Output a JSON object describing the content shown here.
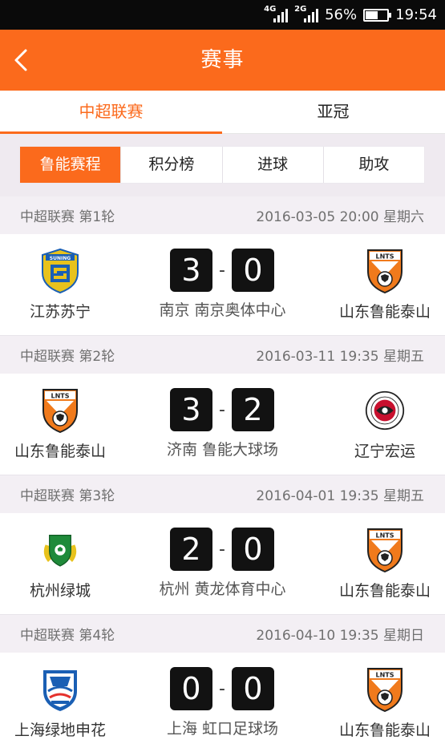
{
  "status_bar": {
    "network1": "4G",
    "network2": "2G",
    "battery_pct": "56%",
    "battery_level": 0.56,
    "time": "19:54"
  },
  "header": {
    "title": "赛事",
    "back_icon": "chevron-left-icon"
  },
  "tabs": [
    {
      "label": "中超联赛",
      "active": true
    },
    {
      "label": "亚冠",
      "active": false
    }
  ],
  "subtabs": [
    {
      "label": "鲁能赛程",
      "active": true
    },
    {
      "label": "积分榜",
      "active": false
    },
    {
      "label": "进球",
      "active": false
    },
    {
      "label": "助攻",
      "active": false
    }
  ],
  "matches": [
    {
      "round": "中超联赛 第1轮",
      "datetime": "2016-03-05 20:00 星期六",
      "home": {
        "name": "江苏苏宁",
        "logo": "suning-logo"
      },
      "away": {
        "name": "山东鲁能泰山",
        "logo": "lnts-logo"
      },
      "home_score": "3",
      "away_score": "0",
      "score_sep": "-",
      "venue": "南京 南京奥体中心"
    },
    {
      "round": "中超联赛 第2轮",
      "datetime": "2016-03-11 19:35 星期五",
      "home": {
        "name": "山东鲁能泰山",
        "logo": "lnts-logo"
      },
      "away": {
        "name": "辽宁宏运",
        "logo": "liaoning-logo"
      },
      "home_score": "3",
      "away_score": "2",
      "score_sep": "-",
      "venue": "济南 鲁能大球场"
    },
    {
      "round": "中超联赛 第3轮",
      "datetime": "2016-04-01 19:35 星期五",
      "home": {
        "name": "杭州绿城",
        "logo": "greentown-logo"
      },
      "away": {
        "name": "山东鲁能泰山",
        "logo": "lnts-logo"
      },
      "home_score": "2",
      "away_score": "0",
      "score_sep": "-",
      "venue": "杭州 黄龙体育中心"
    },
    {
      "round": "中超联赛 第4轮",
      "datetime": "2016-04-10 19:35 星期日",
      "home": {
        "name": "上海绿地申花",
        "logo": "shenhua-logo"
      },
      "away": {
        "name": "山东鲁能泰山",
        "logo": "lnts-logo"
      },
      "home_score": "0",
      "away_score": "0",
      "score_sep": "-",
      "venue": "上海 虹口足球场"
    }
  ],
  "colors": {
    "accent": "#fb6a1c",
    "score_bg": "#121212",
    "round_bg": "#f3eff4"
  }
}
